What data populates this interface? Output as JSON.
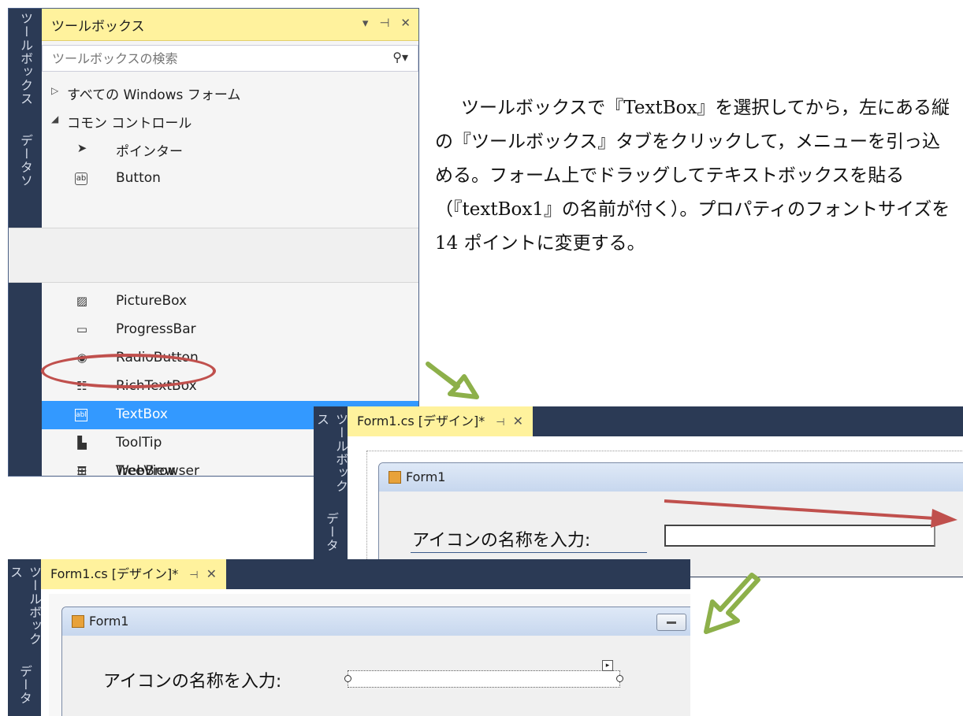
{
  "toolbox": {
    "title": "ツールボックス",
    "title_controls": [
      "▾",
      "⊣",
      "✕"
    ],
    "search_placeholder": "ツールボックスの検索",
    "side_tabs": [
      "ツールボックス",
      "データソ"
    ],
    "groups": [
      {
        "label": "すべての Windows フォーム",
        "expanded": false
      },
      {
        "label": "コモン コントロール",
        "expanded": true
      }
    ],
    "items_top": [
      {
        "label": "ポインター",
        "icon": "pointer-icon"
      },
      {
        "label": "Button",
        "icon": "button-icon"
      }
    ],
    "items_bottom": [
      {
        "label": "PictureBox",
        "icon": "picturebox-icon"
      },
      {
        "label": "ProgressBar",
        "icon": "progressbar-icon"
      },
      {
        "label": "RadioButton",
        "icon": "radiobutton-icon"
      },
      {
        "label": "RichTextBox",
        "icon": "richtextbox-icon"
      },
      {
        "label": "TextBox",
        "icon": "textbox-icon",
        "selected": true
      },
      {
        "label": "ToolTip",
        "icon": "tooltip-icon"
      },
      {
        "label": "TreeView",
        "icon": "treeview-icon"
      },
      {
        "label": "WebBrowser",
        "icon": "webbrowser-icon"
      }
    ]
  },
  "description": "ツールボックスで『TextBox』を選択してから，左にある縦の『ツールボックス』タブをクリックして，メニューを引っ込める。フォーム上でドラッグしてテキストボックスを貼る（『textBox1』の名前が付く）。プロパティのフォントサイズを 14 ポイントに変更する。",
  "designer": {
    "tab_label": "Form1.cs [デザイン]*",
    "pin": "⊣",
    "close": "✕",
    "side_tabs": [
      "ツールボックス",
      "データ"
    ],
    "form_title": "Form1",
    "label_text": "アイコンの名称を入力:",
    "smart_tag": "▸"
  },
  "colors": {
    "ide_dark": "#2b3a55",
    "tab_yellow": "#fff29d",
    "selection": "#3399ff",
    "highlight_red": "#c0504d",
    "arrow_green": "#8db04a"
  }
}
